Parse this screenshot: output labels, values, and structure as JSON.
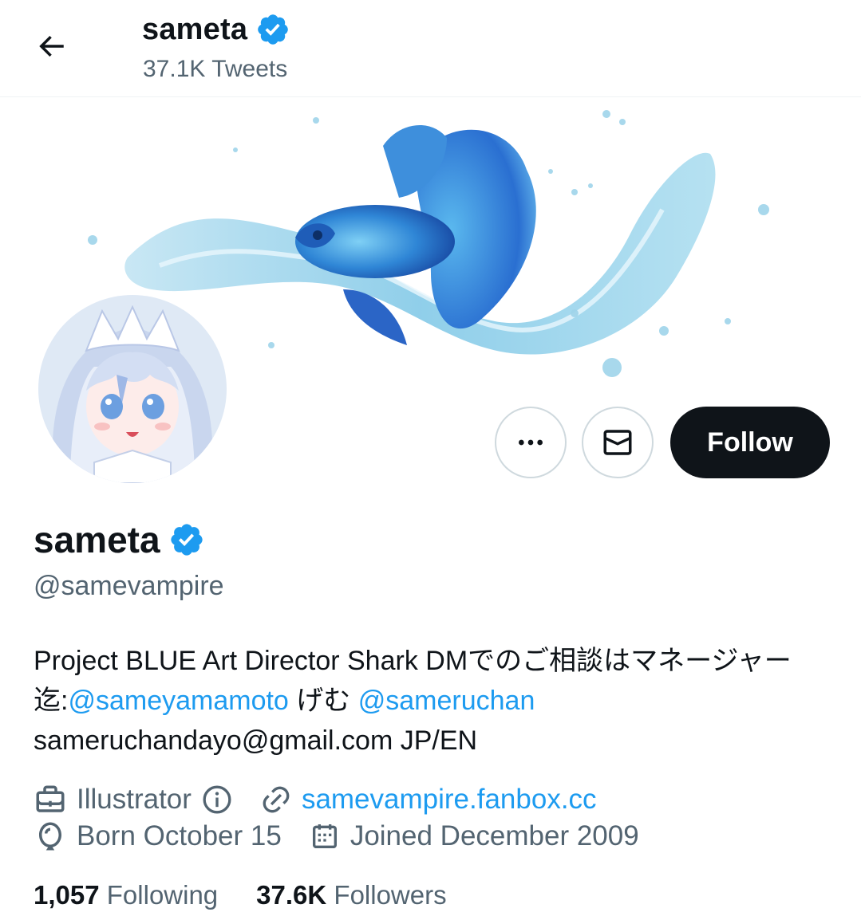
{
  "header": {
    "display_name": "sameta",
    "tweet_count": "37.1K Tweets"
  },
  "profile": {
    "display_name": "sameta",
    "handle": "@samevampire",
    "verified": true,
    "bio": {
      "text_1": "Project BLUE Art Director Shark DMでのご相談はマネージャー迄:",
      "mention_1": "@sameyamamoto",
      "text_2": " げむ ",
      "mention_2": "@sameruchan",
      "text_3": "sameruchandayo@gmail.com JP/EN"
    },
    "profession": "Illustrator",
    "website": "samevampire.fanbox.cc",
    "birthday": "Born October 15",
    "joined": "Joined December 2009"
  },
  "actions": {
    "follow_label": "Follow"
  },
  "stats": {
    "following_count": "1,057",
    "following_label": "Following",
    "followers_count": "37.6K",
    "followers_label": "Followers"
  },
  "icons": {
    "back": "arrow-left-icon",
    "verified": "verified-badge-icon",
    "more": "more-horizontal-icon",
    "message": "envelope-icon",
    "profession": "briefcase-icon",
    "info": "info-icon",
    "link": "link-icon",
    "birthday": "balloon-icon",
    "joined": "calendar-icon"
  },
  "colors": {
    "accent": "#1d9bf0",
    "text_primary": "#0f1419",
    "text_secondary": "#536471",
    "button_dark": "#0f1419"
  }
}
